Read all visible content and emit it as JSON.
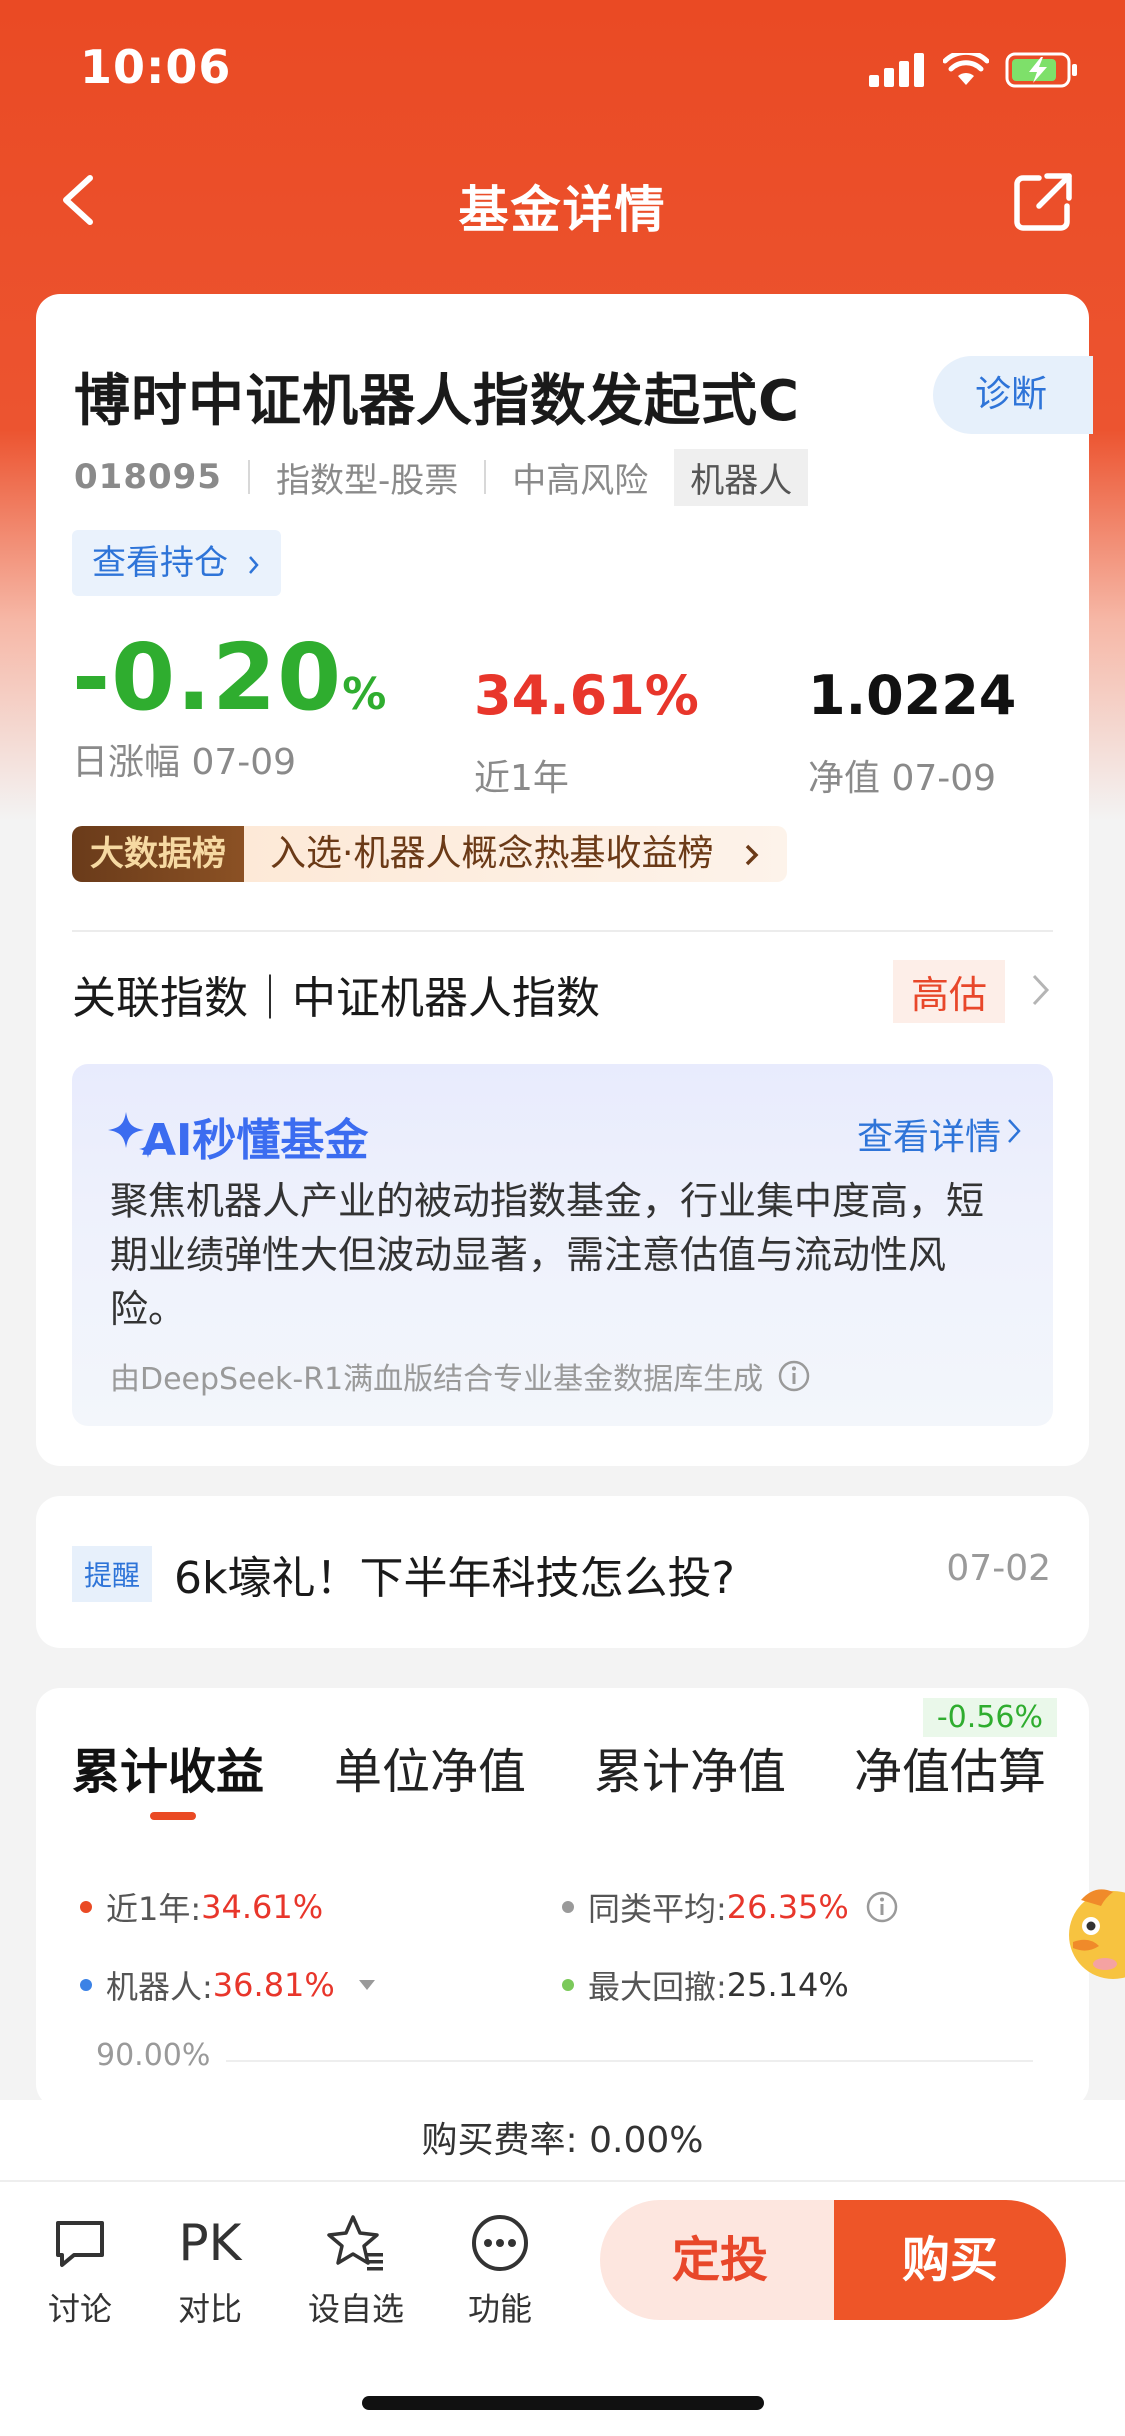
{
  "status_bar": {
    "time": "10:06",
    "icons": [
      "signal-icon",
      "wifi-icon",
      "battery-charging-icon"
    ]
  },
  "nav": {
    "title": "基金详情",
    "back_icon": "chevron-left-icon",
    "share_icon": "share-icon"
  },
  "fund": {
    "name": "博时中证机器人指数发起式C",
    "diagnose_label": "诊断",
    "code": "018095",
    "type": "指数型-股票",
    "risk": "中高风险",
    "theme_tag": "机器人",
    "holdings_label": "查看持仓",
    "daily_change_value": "-0.20",
    "daily_change_unit": "%",
    "daily_change_label": "日涨幅 07-09",
    "one_year_return": "34.61%",
    "one_year_label": "近1年",
    "nav_value": "1.0224",
    "nav_label": "净值 07-09"
  },
  "ranking": {
    "badge": "大数据榜",
    "text": "入选·机器人概念热基收益榜"
  },
  "related_index": {
    "label": "关联指数｜中证机器人指数",
    "valuation": "高估"
  },
  "ai": {
    "title": "AI秒懂基金",
    "detail_link": "查看详情",
    "body": "聚焦机器人产业的被动指数基金，行业集中度高，短期业绩弹性大但波动显著，需注意估值与流动性风险。",
    "source": "由DeepSeek-R1满血版结合专业基金数据库生成"
  },
  "notice": {
    "tag": "提醒",
    "text": "6k壕礼！下半年科技怎么投?",
    "date": "07-02"
  },
  "chart_section": {
    "tabs": [
      "累计收益",
      "单位净值",
      "累计净值",
      "净值估算"
    ],
    "active_tab": 0,
    "estimate_badge": "-0.56%",
    "legend": [
      {
        "name": "近1年:",
        "value": "34.61%",
        "color": "#ea4a24"
      },
      {
        "name": "同类平均:",
        "value": "26.35%",
        "color": "#9a9a9a"
      },
      {
        "name": "机器人:",
        "value": "36.81%",
        "color": "#3b82e6"
      },
      {
        "name": "最大回撤:",
        "value": "25.14%",
        "color": "#7bc95a"
      }
    ],
    "y_axis_top": "90.00%"
  },
  "fee": {
    "text": "购买费率: 0.00%"
  },
  "bottom_bar": {
    "discuss": "讨论",
    "compare_icon_text": "PK",
    "compare": "对比",
    "watchlist": "设自选",
    "functions": "功能",
    "invest_button": "定投",
    "buy_button": "购买"
  },
  "colors": {
    "brand": "#ea4a24",
    "up": "#e8362b",
    "down": "#2fad2f",
    "link": "#2e74d8"
  }
}
